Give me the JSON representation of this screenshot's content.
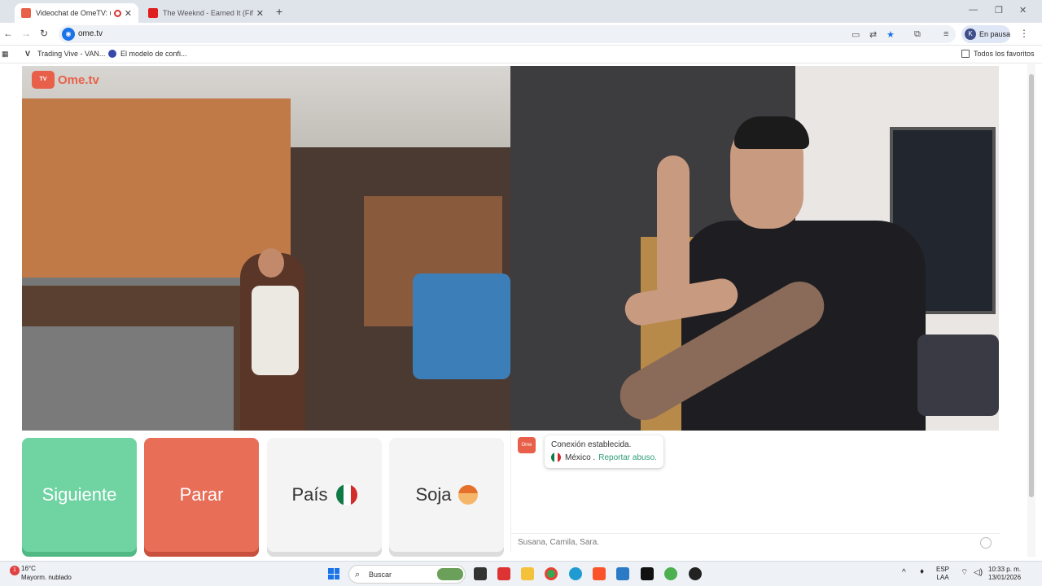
{
  "browser": {
    "tabs": [
      {
        "label": "Videochat de OmeTV: una"
      },
      {
        "label": "The Weeknd - Earned It (Fifty S"
      }
    ],
    "url": "ome.tv",
    "profile_label": "En pausa",
    "profile_initial": "K"
  },
  "bookmarks": {
    "items": [
      {
        "label": "Trading Vive - VAN..."
      },
      {
        "label": "El modelo de confi..."
      }
    ],
    "all_favorites": "Todos los favoritos"
  },
  "page": {
    "logo_text": "Ome.tv",
    "buttons": {
      "next": "Siguiente",
      "stop": "Parar",
      "country": "País",
      "gender": "Soja"
    },
    "chat": {
      "logo_text": "Ome TV",
      "status": "Conexión establecida.",
      "country": "México .",
      "report": "Reportar abuso.",
      "input_placeholder": "Susana, Camila, Sara."
    }
  },
  "taskbar": {
    "weather_temp": "16°C",
    "weather_desc": "Mayorm. nublado",
    "notification_count": "1",
    "search_label": "Buscar",
    "lang_top": "ESP",
    "lang_bottom": "LAA",
    "time": "10:33 p. m.",
    "date": "13/01/2026"
  },
  "colors": {
    "next_button": "#6fd3a2",
    "stop_button": "#e86e58",
    "brand": "#e8604a"
  }
}
